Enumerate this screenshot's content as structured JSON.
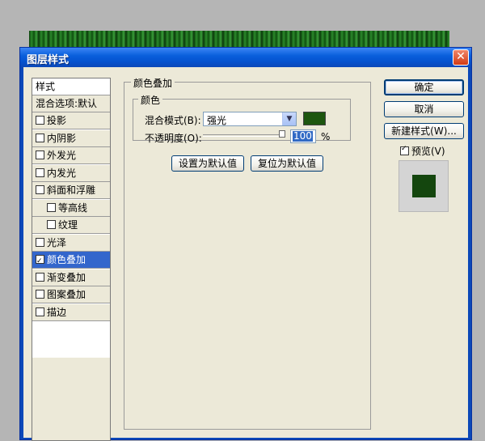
{
  "window": {
    "title": "图层样式",
    "close_label": "✕"
  },
  "sidebar": {
    "header": "样式",
    "blend_options": "混合选项:默认",
    "items": [
      {
        "label": "投影",
        "checked": false,
        "indent": false
      },
      {
        "label": "内阴影",
        "checked": false,
        "indent": false
      },
      {
        "label": "外发光",
        "checked": false,
        "indent": false
      },
      {
        "label": "内发光",
        "checked": false,
        "indent": false
      },
      {
        "label": "斜面和浮雕",
        "checked": false,
        "indent": false
      },
      {
        "label": "等高线",
        "checked": false,
        "indent": true
      },
      {
        "label": "纹理",
        "checked": false,
        "indent": true
      },
      {
        "label": "光泽",
        "checked": false,
        "indent": false
      },
      {
        "label": "颜色叠加",
        "checked": true,
        "indent": false,
        "selected": true
      },
      {
        "label": "渐变叠加",
        "checked": false,
        "indent": false
      },
      {
        "label": "图案叠加",
        "checked": false,
        "indent": false
      },
      {
        "label": "描边",
        "checked": false,
        "indent": false
      }
    ]
  },
  "panel": {
    "group_title": "颜色叠加",
    "color_group_title": "颜色",
    "blend_mode_label": "混合模式(B):",
    "blend_mode_value": "强光",
    "overlay_color": "#1d560f",
    "opacity_label": "不透明度(O):",
    "opacity_value": "100",
    "opacity_fraction": 1.0,
    "opacity_unit": "%",
    "set_default_label": "设置为默认值",
    "reset_default_label": "复位为默认值"
  },
  "actions": {
    "ok_label": "确定",
    "cancel_label": "取消",
    "new_style_label": "新建样式(W)...",
    "preview_label": "预览(V)",
    "preview_checked": true,
    "preview_color": "#14460e"
  }
}
